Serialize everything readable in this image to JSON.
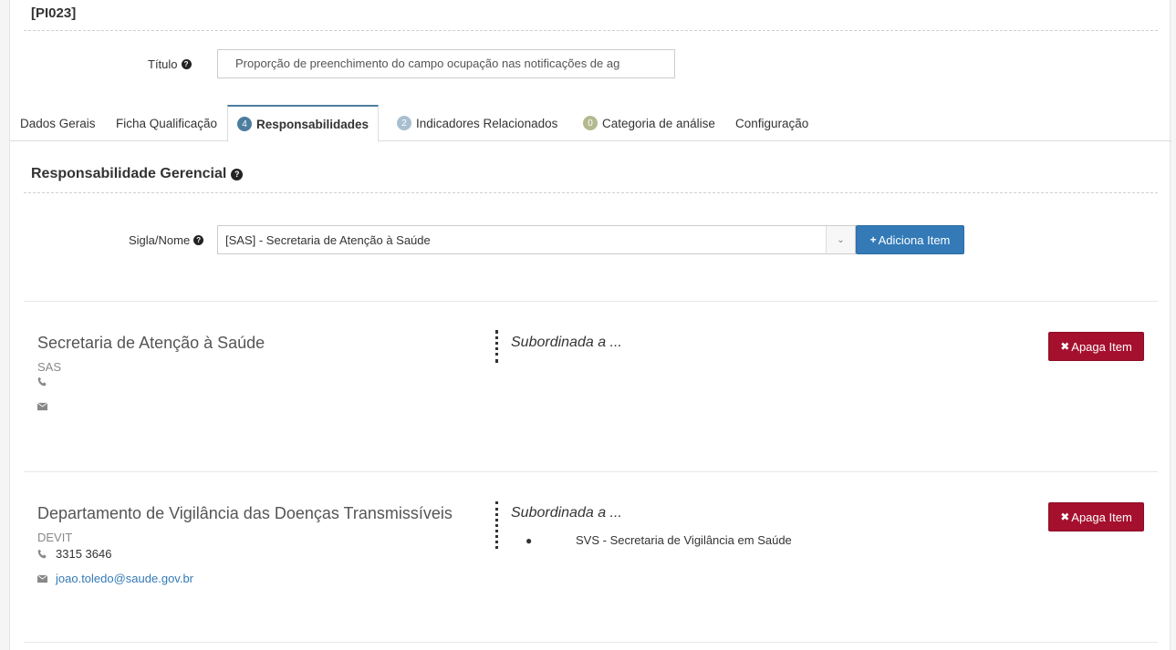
{
  "header": {
    "code": "[PI023]",
    "titulo_label": "Título",
    "titulo_value": "Proporção de preenchimento do campo ocupação nas notificações de ag"
  },
  "tabs": [
    {
      "label": "Dados Gerais",
      "badge": null
    },
    {
      "label": "Ficha Qualificação",
      "badge": null
    },
    {
      "label": "Responsabilidades",
      "badge": "4",
      "badge_color": "#4c7d9f",
      "active": true
    },
    {
      "label": "Indicadores Relacionados",
      "badge": "2",
      "badge_color": "#a8bfd0"
    },
    {
      "label": "Categoria de análise",
      "badge": "0",
      "badge_color": "#b5b98f"
    },
    {
      "label": "Configuração",
      "badge": null
    }
  ],
  "section": {
    "heading": "Responsabilidade Gerencial",
    "sigla_label": "Sigla/Nome",
    "select_value": "[SAS] - Secretaria de Atenção à Saúde",
    "add_button": "Adiciona Item"
  },
  "items": [
    {
      "name": "Secretaria de Atenção à Saúde",
      "acronym": "SAS",
      "phone": "",
      "email": "",
      "subordinada_label": "Subordinada a ...",
      "subordinates": [],
      "delete_button": "Apaga Item"
    },
    {
      "name": "Departamento de Vigilância das Doenças Transmissíveis",
      "acronym": "DEVIT",
      "phone": "3315 3646",
      "email": "joao.toledo@saude.gov.br",
      "subordinada_label": "Subordinada a ...",
      "subordinates": [
        "SVS - Secretaria de Vigilância em Saúde"
      ],
      "delete_button": "Apaga Item"
    }
  ],
  "colors": {
    "primary": "#337ab7",
    "danger": "#a5102e",
    "link": "#337ab7"
  },
  "icons": {
    "help": "question-circle-icon",
    "phone": "phone-icon",
    "email": "envelope-icon",
    "plus": "plus-icon",
    "delete": "times-icon"
  }
}
